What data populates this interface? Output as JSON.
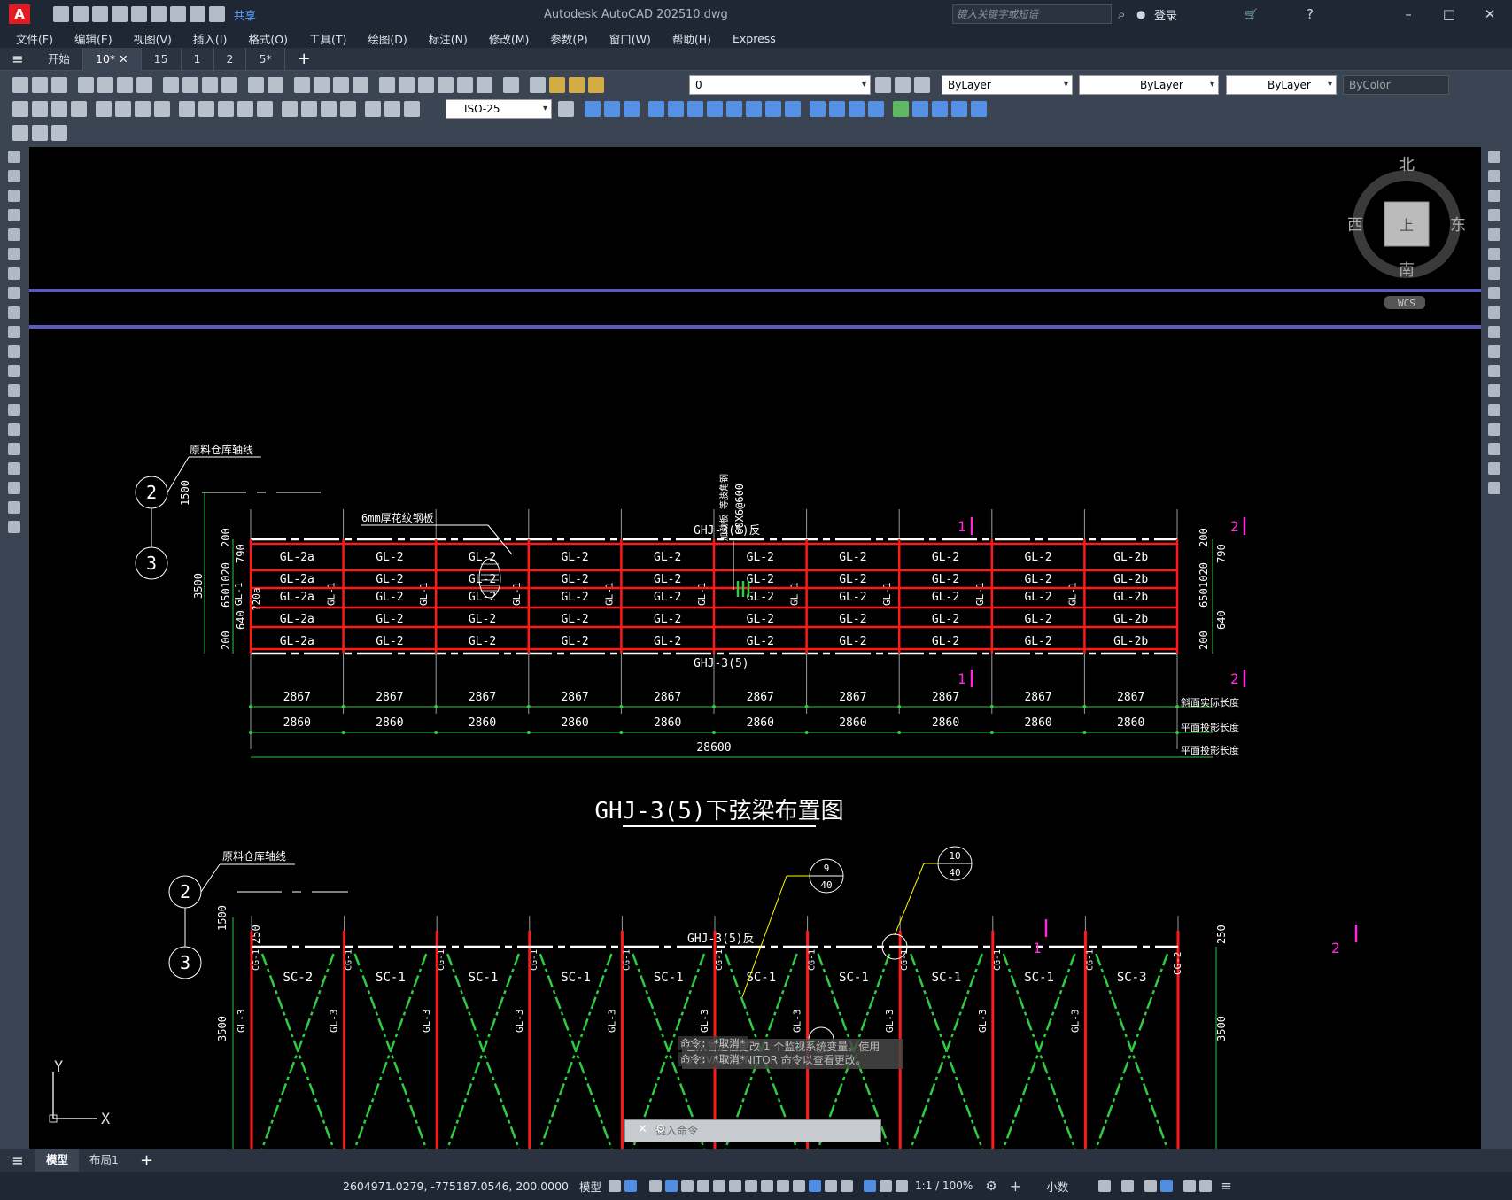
{
  "titlebar": {
    "app_badge": "A",
    "share": "共享",
    "title": "Autodesk AutoCAD 2025",
    "filename": "10.dwg",
    "search_placeholder": "键入关键字或短语",
    "login": "登录",
    "minimize": "–",
    "maximize": "□",
    "close": "✕"
  },
  "menu": [
    "文件(F)",
    "编辑(E)",
    "视图(V)",
    "插入(I)",
    "格式(O)",
    "工具(T)",
    "绘图(D)",
    "标注(N)",
    "修改(M)",
    "参数(P)",
    "窗口(W)",
    "帮助(H)",
    "Express"
  ],
  "tabs": [
    "开始",
    "10*",
    "15",
    "1",
    "2",
    "5*"
  ],
  "toolbar": {
    "layer": "0",
    "color": "ByLayer",
    "linetype": "ByLayer",
    "lineweight": "ByLayer",
    "plotstyle": "ByColor",
    "dimstyle": "ISO-25"
  },
  "viewcube": {
    "north": "北",
    "south": "南",
    "east": "东",
    "west": "西",
    "top": "上",
    "wcs": "WCS"
  },
  "ucs": {
    "x": "X",
    "y": "Y"
  },
  "drawing1": {
    "axis_label": "原料仓库轴线",
    "grid_a": "2",
    "grid_b": "3",
    "plate_note": "6mm厚花纹钢板",
    "beam_top": "GHJ-3(5)反",
    "beam_bottom": "GHJ-3(5)",
    "rod_note": "-60X6@600",
    "rod_note2": "加劲板 等肢角钢",
    "left_dims": [
      "1500",
      "200",
      "790",
      "1020",
      "650",
      "640",
      "200",
      "3500"
    ],
    "right_dims": [
      "200",
      "790",
      "1020",
      "650",
      "640",
      "200"
    ],
    "col_label": "GL-1",
    "col_label_a": "?20a",
    "rows": [
      [
        "GL-2a",
        "GL-2",
        "GL-2",
        "GL-2",
        "GL-2",
        "GL-2",
        "GL-2",
        "GL-2",
        "GL-2",
        "GL-2b"
      ],
      [
        "GL-2a",
        "GL-2",
        "GL-2",
        "GL-2",
        "GL-2",
        "GL-2",
        "GL-2",
        "GL-2",
        "GL-2",
        "GL-2b"
      ],
      [
        "GL-2a",
        "GL-2",
        "GL-2",
        "GL-2",
        "GL-2",
        "GL-2",
        "GL-2",
        "GL-2",
        "GL-2",
        "GL-2b"
      ],
      [
        "GL-2a",
        "GL-2",
        "GL-2",
        "GL-2",
        "GL-2",
        "GL-2",
        "GL-2",
        "GL-2",
        "GL-2",
        "GL-2b"
      ],
      [
        "GL-2a",
        "GL-2",
        "GL-2",
        "GL-2",
        "GL-2",
        "GL-2",
        "GL-2",
        "GL-2",
        "GL-2",
        "GL-2b"
      ]
    ],
    "span_slope": [
      "2867",
      "2867",
      "2867",
      "2867",
      "2867",
      "2867",
      "2867",
      "2867",
      "2867",
      "2867"
    ],
    "span_plan": [
      "2860",
      "2860",
      "2860",
      "2860",
      "2860",
      "2860",
      "2860",
      "2860",
      "2860",
      "2860"
    ],
    "total": "28600",
    "label_slope": "斜面实际长度",
    "label_plan": "平面投影长度",
    "label_total": "平面投影长度",
    "section_mark": "1",
    "section_mark2": "2",
    "title": "GHJ-3(5)下弦梁布置图"
  },
  "drawing2": {
    "axis_label": "原料仓库轴线",
    "grid_a": "2",
    "grid_b": "3",
    "dims": [
      "1500",
      "250",
      "3500"
    ],
    "right_dims": [
      "250",
      "3500"
    ],
    "beam": "GHJ-3(5)反",
    "bubble1_top": "9",
    "bubble1_bot": "40",
    "bubble2_top": "10",
    "bubble2_bot": "40",
    "brace_labels": [
      "SC-2",
      "SC-1",
      "SC-1",
      "SC-1",
      "SC-1",
      "SC-1",
      "SC-1",
      "SC-1",
      "SC-1",
      "SC-3"
    ],
    "cg": "CG-2",
    "cgl": "CG-1",
    "gl": "GL-3"
  },
  "command": {
    "notice": "已从首选值更改 1 个监视系统变量。使用 SYSVARMONITOR 命令以查看更改。",
    "hist1": "命令: *取消*",
    "hist2": "命令: *取消*",
    "placeholder": "键入命令"
  },
  "layout_tabs": [
    "模型",
    "布局1"
  ],
  "status": {
    "coords": "2604971.0279, -775187.0546, 200.0000",
    "model": "模型",
    "scale": "1:1 / 100%",
    "units": "小数"
  },
  "colors": {
    "accent": "#e21b23",
    "beam": "#ff1a1a",
    "dim": "#2ecc40",
    "magenta": "#ff2bd6",
    "grid": "#5b5bbf"
  }
}
